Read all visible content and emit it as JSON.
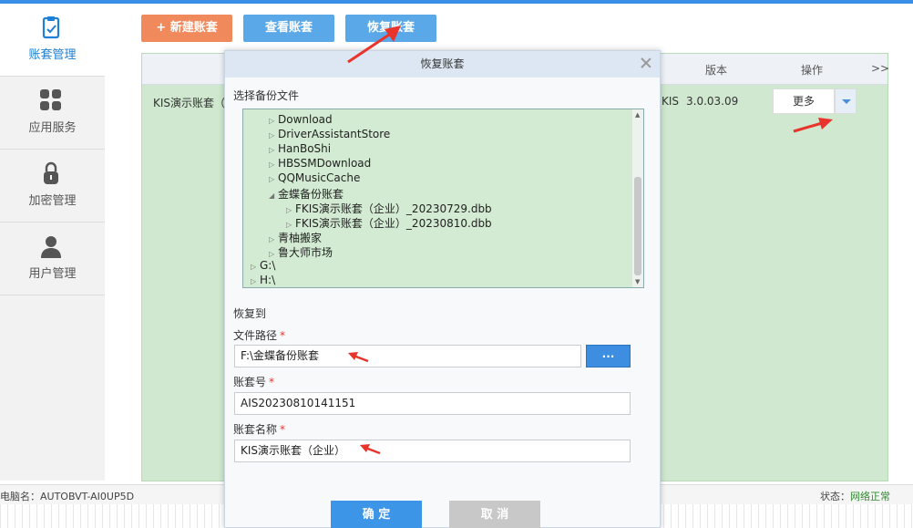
{
  "sidebar": {
    "items": [
      {
        "label": "账套管理",
        "icon": "clipboard-icon"
      },
      {
        "label": "应用服务",
        "icon": "apps-grid-icon"
      },
      {
        "label": "加密管理",
        "icon": "lock-icon"
      },
      {
        "label": "用户管理",
        "icon": "user-icon"
      }
    ]
  },
  "toolbar": {
    "new_label": "新建账套",
    "view_label": "查看账套",
    "restore_label": "恢复账套"
  },
  "grid": {
    "headers": {
      "version": "版本",
      "action": "操作",
      "expand": ">>"
    },
    "row": {
      "name": "KIS演示账套（",
      "name_tail": "KIS",
      "version": "3.0.03.09",
      "more": "更多"
    }
  },
  "status": {
    "pc_label": "电脑名：AUTOBVT-AI0UP5D",
    "state_label": "状态：",
    "state_value": "网络正常"
  },
  "dialog": {
    "title": "恢复账套",
    "select_backup_label": "选择备份文件",
    "tree": [
      {
        "label": "Download",
        "level": 1,
        "expand": "collapsed"
      },
      {
        "label": "DriverAssistantStore",
        "level": 1,
        "expand": "collapsed"
      },
      {
        "label": "HanBoShi",
        "level": 1,
        "expand": "collapsed"
      },
      {
        "label": "HBSSMDownload",
        "level": 1,
        "expand": "collapsed"
      },
      {
        "label": "QQMusicCache",
        "level": 1,
        "expand": "collapsed"
      },
      {
        "label": "金蝶备份账套",
        "level": 1,
        "expand": "expanded"
      },
      {
        "label": "FKIS演示账套（企业）_20230729.dbb",
        "level": 2,
        "expand": "collapsed"
      },
      {
        "label": "FKIS演示账套（企业）_20230810.dbb",
        "level": 2,
        "expand": "collapsed"
      },
      {
        "label": "青柚搬家",
        "level": 1,
        "expand": "collapsed"
      },
      {
        "label": "鲁大师市场",
        "level": 1,
        "expand": "collapsed"
      },
      {
        "label": "G:\\",
        "level": 0,
        "expand": "collapsed"
      },
      {
        "label": "H:\\",
        "level": 0,
        "expand": "collapsed"
      }
    ],
    "restore_to_label": "恢复到",
    "file_path_label": "文件路径",
    "file_path_value": "F:\\金蝶备份账套",
    "browse_label": "...",
    "account_no_label": "账套号",
    "account_no_value": "AIS20230810141151",
    "account_name_label": "账套名称",
    "account_name_value": "KIS演示账套（企业）",
    "required_mark": "*",
    "ok_label": "确 定",
    "cancel_label": "取 消"
  },
  "colors": {
    "accent": "#3d95e8",
    "new_button": "#f08a5d",
    "grid_bg": "#cfe8cf",
    "annotation_arrow": "#e8342b"
  }
}
